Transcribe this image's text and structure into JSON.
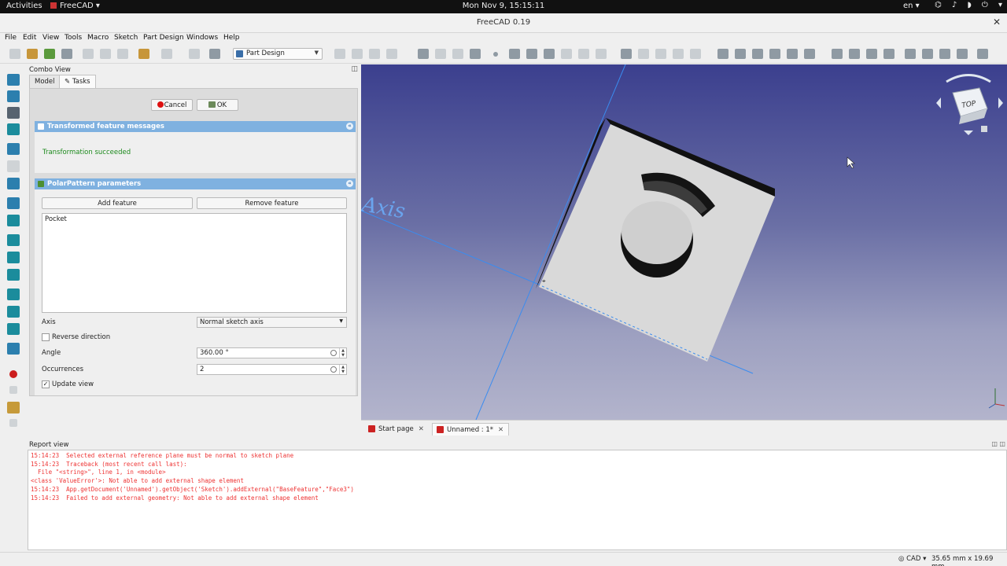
{
  "system_bar": {
    "activities": "Activities",
    "app_name": "FreeCAD ▾",
    "clock": "Mon Nov  9, 15:15:11",
    "language": "en ▾",
    "tray": "⌬ ♪ ◗ ⏻ ▾"
  },
  "window": {
    "title": "FreeCAD 0.19",
    "close": "✕"
  },
  "menu": {
    "items": [
      "File",
      "Edit",
      "View",
      "Tools",
      "Macro",
      "Sketch",
      "Part Design",
      "Windows",
      "Help"
    ]
  },
  "toolbar": {
    "workbench": "Part Design"
  },
  "combo_view": {
    "title": "Combo View",
    "close": "◫",
    "tabs": [
      "Model",
      "✎ Tasks"
    ],
    "cancel_label": "Cancel",
    "ok_label": "OK",
    "messages_panel": {
      "title": "Transformed feature messages",
      "message": "Transformation succeeded"
    },
    "params_panel": {
      "title": "PolarPattern parameters",
      "add_feature": "Add feature",
      "remove_feature": "Remove feature",
      "features": [
        "Pocket"
      ],
      "axis_label": "Axis",
      "axis_value": "Normal sketch axis",
      "reverse_label": "Reverse direction",
      "reverse_checked": false,
      "angle_label": "Angle",
      "angle_value": "360.00 °",
      "occurrences_label": "Occurrences",
      "occurrences_value": "2",
      "update_label": "Update view",
      "update_checked": true,
      "update_mark": "✓"
    }
  },
  "view3d": {
    "axis_label": "Axis",
    "navcube_face": "TOP"
  },
  "document_tabs": [
    {
      "label": "Start page",
      "close": "✕"
    },
    {
      "label": "Unnamed : 1*",
      "close": "✕"
    }
  ],
  "report_view": {
    "title": "Report view",
    "controls": "◫ ◫",
    "lines": [
      "15:14:23  Selected external reference plane must be normal to sketch plane",
      "15:14:23  Traceback (most recent call last):",
      "  File \"<string>\", line 1, in <module>",
      "<class 'ValueError'>: Not able to add external shape element",
      "15:14:23  App.getDocument('Unnamed').getObject('Sketch').addExternal(\"BaseFeature\",\"Face3\")",
      "15:14:23  Failed to add external geometry: Not able to add external shape element"
    ]
  },
  "status_bar": {
    "navigation": "◎ CAD ▾",
    "dimensions": "35.65 mm x 19.69 mm"
  }
}
